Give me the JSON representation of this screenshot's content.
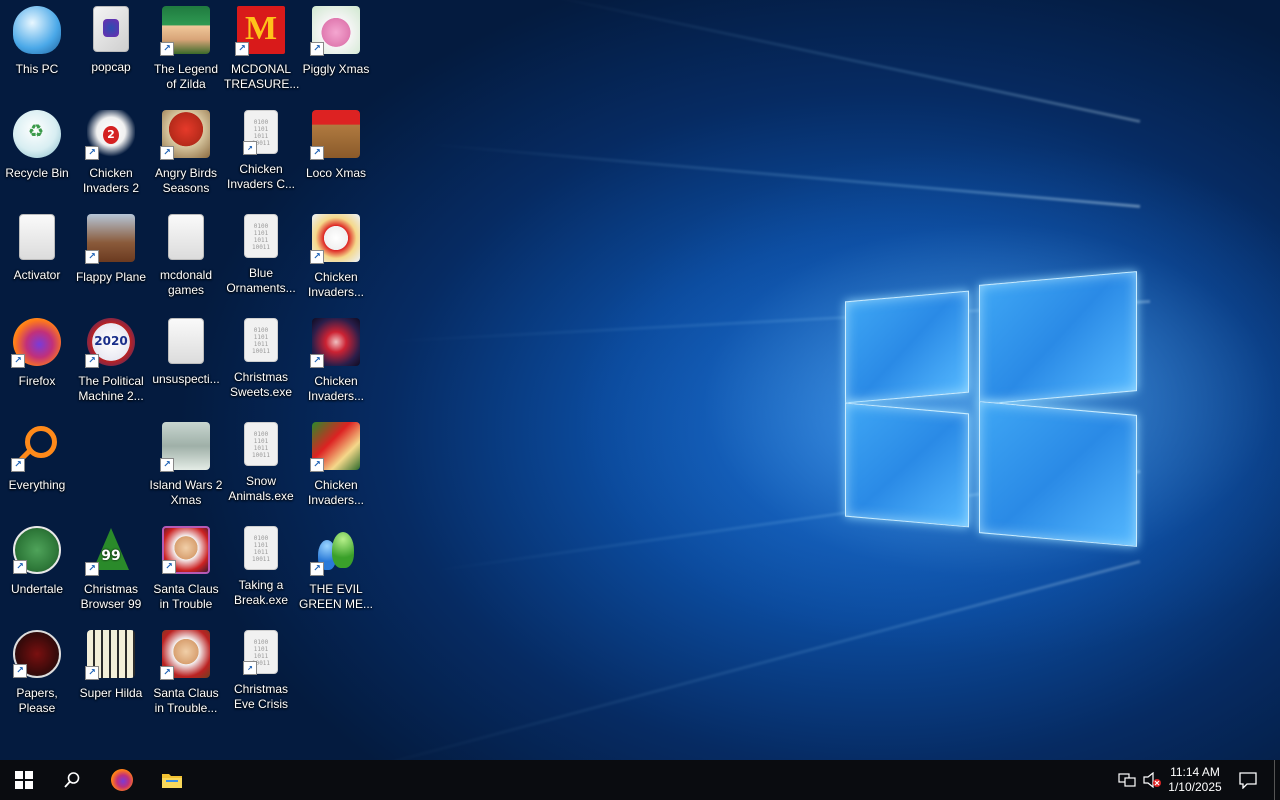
{
  "desktop": {
    "icons": [
      {
        "label": "This PC"
      },
      {
        "label": "popcap"
      },
      {
        "label": "The Legend\nof Zilda"
      },
      {
        "label": "MCDONAL\nTREASURE..."
      },
      {
        "label": "Piggly Xmas"
      },
      {
        "label": "Recycle Bin"
      },
      {
        "label": "Chicken\nInvaders 2"
      },
      {
        "label": "Angry Birds\nSeasons"
      },
      {
        "label": "Chicken\nInvaders C..."
      },
      {
        "label": "Loco Xmas"
      },
      {
        "label": "Activator"
      },
      {
        "label": "Flappy Plane"
      },
      {
        "label": "mcdonald\ngames"
      },
      {
        "label": "Blue\nOrnaments..."
      },
      {
        "label": "Chicken\nInvaders..."
      },
      {
        "label": "Firefox"
      },
      {
        "label": "The Political\nMachine 2..."
      },
      {
        "label": "unsuspecti..."
      },
      {
        "label": "Christmas\nSweets.exe"
      },
      {
        "label": "Chicken\nInvaders..."
      },
      {
        "label": "Everything"
      },
      {
        "label": "Island Wars 2\nXmas"
      },
      {
        "label": "Snow\nAnimals.exe"
      },
      {
        "label": "Chicken\nInvaders..."
      },
      {
        "label": "Undertale"
      },
      {
        "label": "Christmas\nBrowser 99"
      },
      {
        "label": "Santa Claus\nin Trouble"
      },
      {
        "label": "Taking a\nBreak.exe"
      },
      {
        "label": "THE EVIL\nGREEN ME..."
      },
      {
        "label": "Papers,\nPlease"
      },
      {
        "label": "Super Hilda"
      },
      {
        "label": "Santa Claus\nin Trouble..."
      },
      {
        "label": "Christmas\nEve Crisis"
      }
    ],
    "binary_glyph": "0100\n1101\n1011\n10011",
    "mcd_glyph": "M",
    "politics_glyph": "2020",
    "tree_glyph": "99"
  },
  "taskbar": {
    "time": "11:14 AM",
    "date": "1/10/2025",
    "pinned": [
      "firefox-icon",
      "file-explorer-icon"
    ]
  },
  "colors": {
    "taskbar_bg": "#0a0c10",
    "accent_blue": "#1a6fd0"
  }
}
